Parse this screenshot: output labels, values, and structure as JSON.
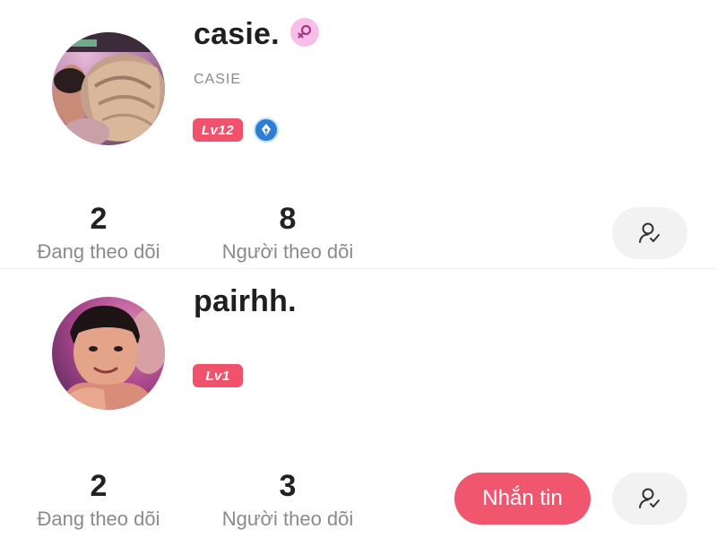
{
  "colors": {
    "level_badge": "#f1516a",
    "message_button": "#f1566f",
    "gender_badge": "#f7bfe8",
    "creator_badge": "#2d7dd2",
    "text_primary": "#1f1f1f",
    "text_secondary": "#8a8a8a"
  },
  "profiles": [
    {
      "display_name": "casie.",
      "gender_icon": "female-symbol-icon",
      "username": "CASIE",
      "level": "Lv12",
      "creator_badge_icon": "pen-nib-icon",
      "following_count": "2",
      "following_label": "Đang theo dõi",
      "followers_count": "8",
      "followers_label": "Người theo dõi",
      "follow_status_icon": "user-check-icon"
    },
    {
      "display_name": "pairhh.",
      "level": "Lv1",
      "following_count": "2",
      "following_label": "Đang theo dõi",
      "followers_count": "3",
      "followers_label": "Người theo dõi",
      "message_label": "Nhắn tin",
      "follow_status_icon": "user-check-icon"
    }
  ]
}
